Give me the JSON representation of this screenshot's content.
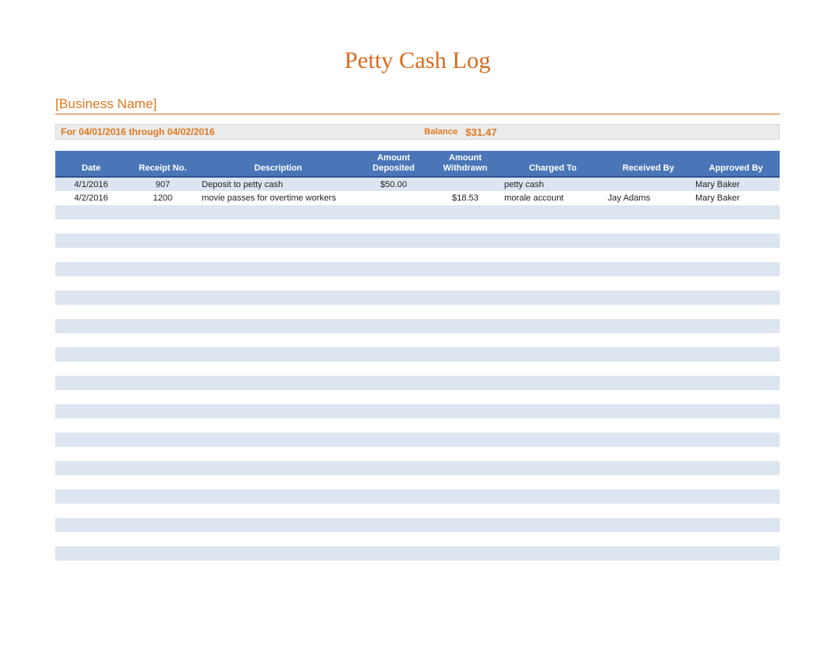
{
  "header": {
    "title": "Petty Cash Log",
    "business_name": "[Business Name]",
    "period": "For 04/01/2016 through 04/02/2016",
    "balance_label": "Balance",
    "balance_value": "$31.47"
  },
  "columns": {
    "date": "Date",
    "receipt": "Receipt No.",
    "description": "Description",
    "deposited": "Amount Deposited",
    "withdrawn": "Amount Withdrawn",
    "charged_to": "Charged To",
    "received_by": "Received By",
    "approved_by": "Approved By"
  },
  "rows": [
    {
      "date": "4/1/2016",
      "receipt": "907",
      "description": "Deposit to petty cash",
      "deposited": "$50.00",
      "withdrawn": "",
      "charged_to": "petty cash",
      "received_by": "",
      "approved_by": "Mary Baker"
    },
    {
      "date": "4/2/2016",
      "receipt": "1200",
      "description": "movie passes for overtime workers",
      "deposited": "",
      "withdrawn": "$18.53",
      "charged_to": "morale account",
      "received_by": "Jay Adams",
      "approved_by": "Mary Baker"
    }
  ],
  "empty_row_count": 26
}
